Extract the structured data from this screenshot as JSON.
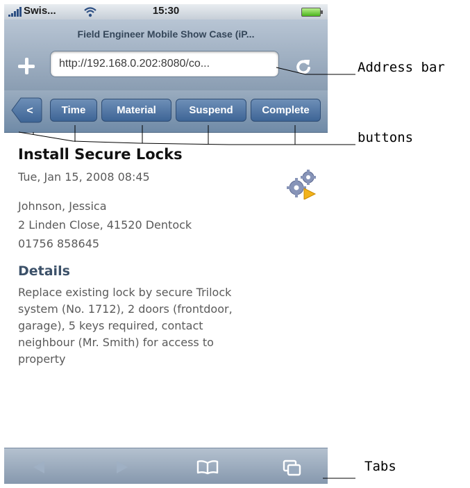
{
  "status_bar": {
    "carrier": "Swis...",
    "time": "15:30"
  },
  "browser": {
    "page_title": "Field Engineer Mobile Show Case (iP...",
    "address": "http://192.168.0.202:8080/co..."
  },
  "toolbar": {
    "back_label": "<",
    "buttons": [
      "Time",
      "Material",
      "Suspend",
      "Complete"
    ]
  },
  "task": {
    "title": "Install Secure Locks",
    "date": "Tue, Jan 15, 2008 08:45",
    "contact_name": "Johnson, Jessica",
    "address": "2 Linden Close, 41520 Dentock",
    "phone": "01756 858645",
    "details_heading": "Details",
    "details_lines": [
      "Replace existing lock by secure Trilock",
      "system (No. 1712), 2 doors (frontdoor,",
      "garage), 5 keys required, contact",
      "neighbour (Mr. Smith) for access to",
      "property"
    ]
  },
  "annotations": {
    "address_bar": "Address bar",
    "buttons": "buttons",
    "tabs": "Tabs"
  },
  "colors": {
    "toolbar_button": "#3e6596",
    "details_heading": "#3c5169"
  },
  "icons": {
    "bottom_bar": [
      "back-arrow-icon",
      "forward-arrow-icon",
      "bookmarks-icon",
      "tabs-icon"
    ],
    "task": "gears-icon",
    "reload": "reload-icon",
    "add": "plus-icon"
  }
}
